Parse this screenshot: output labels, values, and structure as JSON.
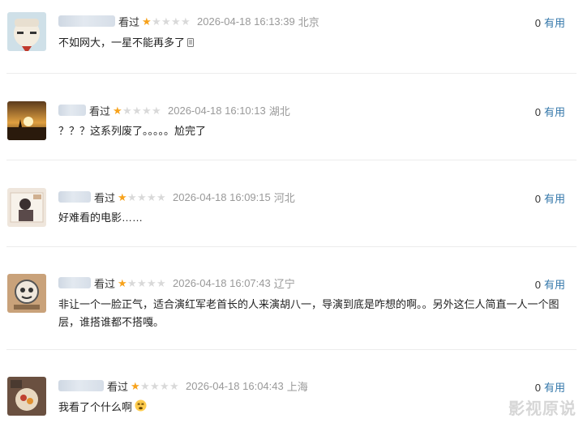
{
  "comments": [
    {
      "watched": "看过",
      "rating": 1,
      "time": "2026-04-18 16:13:39",
      "location": "北京",
      "useful_count": "0",
      "useful_label": "有用",
      "text": "不如网大，一星不能再多了"
    },
    {
      "watched": "看过",
      "rating": 1,
      "time": "2026-04-18 16:10:13",
      "location": "湖北",
      "useful_count": "0",
      "useful_label": "有用",
      "text": "？？？这系列废了。。。。。尬完了"
    },
    {
      "watched": "看过",
      "rating": 1,
      "time": "2026-04-18 16:09:15",
      "location": "河北",
      "useful_count": "0",
      "useful_label": "有用",
      "text": "好难看的电影……"
    },
    {
      "watched": "看过",
      "rating": 1,
      "time": "2026-04-18 16:07:43",
      "location": "辽宁",
      "useful_count": "0",
      "useful_label": "有用",
      "text": "非让一个一脸正气，适合演红军老首长的人来演胡八一，导演到底是咋想的啊。。另外这仨人简直一人一个图层，谁搭谁都不搭嘎。"
    },
    {
      "watched": "看过",
      "rating": 1,
      "time": "2026-04-18 16:04:43",
      "location": "上海",
      "useful_count": "0",
      "useful_label": "有用",
      "text": "我看了个什么啊"
    }
  ],
  "watermark": "影视原说",
  "icons": {
    "star_filled": "star-filled-icon",
    "star_empty": "star-empty-icon",
    "emoji_face": "dizzy-face-icon"
  },
  "colors": {
    "star": "#f7a21b",
    "link": "#3377aa",
    "meta": "#999999"
  }
}
